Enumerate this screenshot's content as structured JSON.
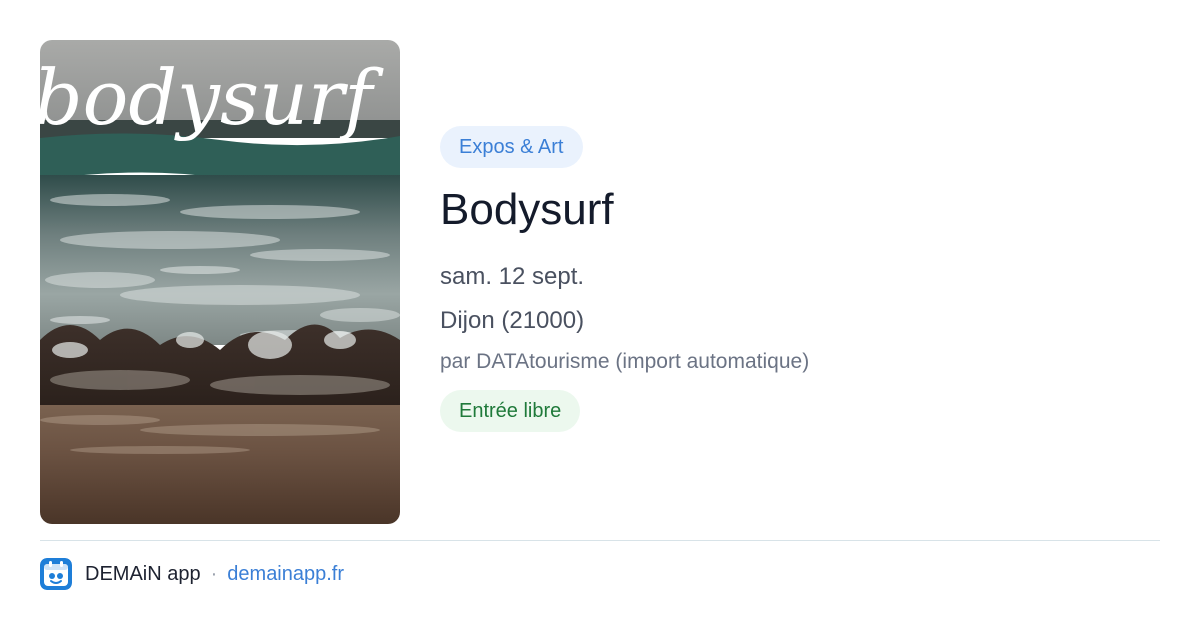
{
  "event": {
    "poster_text": "bodysurf",
    "category": "Expos & Art",
    "title": "Bodysurf",
    "date": "sam. 12 sept.",
    "location": "Dijon (21000)",
    "source": "par DATAtourisme (import automatique)",
    "price": "Entrée libre"
  },
  "footer": {
    "app_name": "DEMAiN app",
    "separator": "·",
    "link": "demainapp.fr",
    "icon": "demain-app-icon"
  },
  "colors": {
    "category_bg": "#eaf2fd",
    "category_text": "#3b7fd6",
    "price_bg": "#ecf8ee",
    "price_text": "#1f7a3a",
    "title": "#141b2b",
    "link": "#3b7fd6"
  }
}
